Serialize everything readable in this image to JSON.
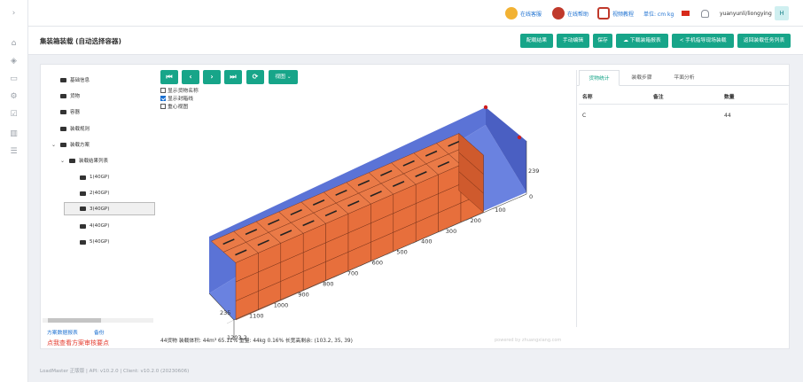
{
  "header": {
    "online_service": "在线客服",
    "online_help": "在线帮助",
    "video_tutorial": "视频教程",
    "unit": "单位: cm kg",
    "username": "yuanyunli/liongying",
    "avatar_letter": "H"
  },
  "page": {
    "title": "集装箱装载 (自动选择容器)",
    "buttons": [
      "配载结果",
      "手动编辑",
      "保存",
      "下载装箱报表",
      "手机指导现场装载",
      "返回装载任务列表"
    ]
  },
  "tree": {
    "items": [
      {
        "label": "基础信息",
        "level": 0
      },
      {
        "label": "货物",
        "level": 0
      },
      {
        "label": "容器",
        "level": 0
      },
      {
        "label": "装载规则",
        "level": 0
      },
      {
        "label": "装载方案",
        "level": 0,
        "expanded": true
      },
      {
        "label": "装载结果列表",
        "level": 1,
        "expanded": true
      },
      {
        "label": "1(40GP)",
        "level": 2
      },
      {
        "label": "2(40GP)",
        "level": 2
      },
      {
        "label": "3(40GP)",
        "level": 2,
        "selected": true
      },
      {
        "label": "4(40GP)",
        "level": 2
      },
      {
        "label": "5(40GP)",
        "level": 2
      }
    ],
    "link_compare": "方案数据报表",
    "link_backup": "备份",
    "hint_red": "点我查看方案审核要点"
  },
  "viewer": {
    "view_button": "视图",
    "checkboxes": [
      {
        "label": "显示货物名称",
        "checked": false
      },
      {
        "label": "显示封箱线",
        "checked": true
      },
      {
        "label": "重心视图",
        "checked": false
      }
    ],
    "axis_ticks_length": [
      "100",
      "200",
      "300",
      "400",
      "500",
      "600",
      "700",
      "800",
      "900",
      "1000",
      "1100"
    ],
    "label_length_end": "1203.2",
    "label_width": "235",
    "label_height": "239",
    "label_zero": "0",
    "summary": "44货物 装载体积: 44m³ 65.11% 重量: 44kg 0.16% 长宽高剩余: (103.2, 35, 39)",
    "powered": "powered by zhuangxiang.com"
  },
  "right_panel": {
    "tabs": [
      "货物统计",
      "装载步骤",
      "平面分析"
    ],
    "columns": [
      "名称",
      "备注",
      "数量"
    ],
    "rows": [
      [
        "C",
        "",
        "44"
      ]
    ]
  },
  "footer": {
    "text": "LoadMaster 正版版 | API: v10.2.0 | Client: v10.2.0 (20230606)"
  },
  "colors": {
    "accent": "#17a589",
    "box_front": "#e76f3c",
    "box_side": "#cf5a2d",
    "container_wall": "#5b73d6"
  }
}
